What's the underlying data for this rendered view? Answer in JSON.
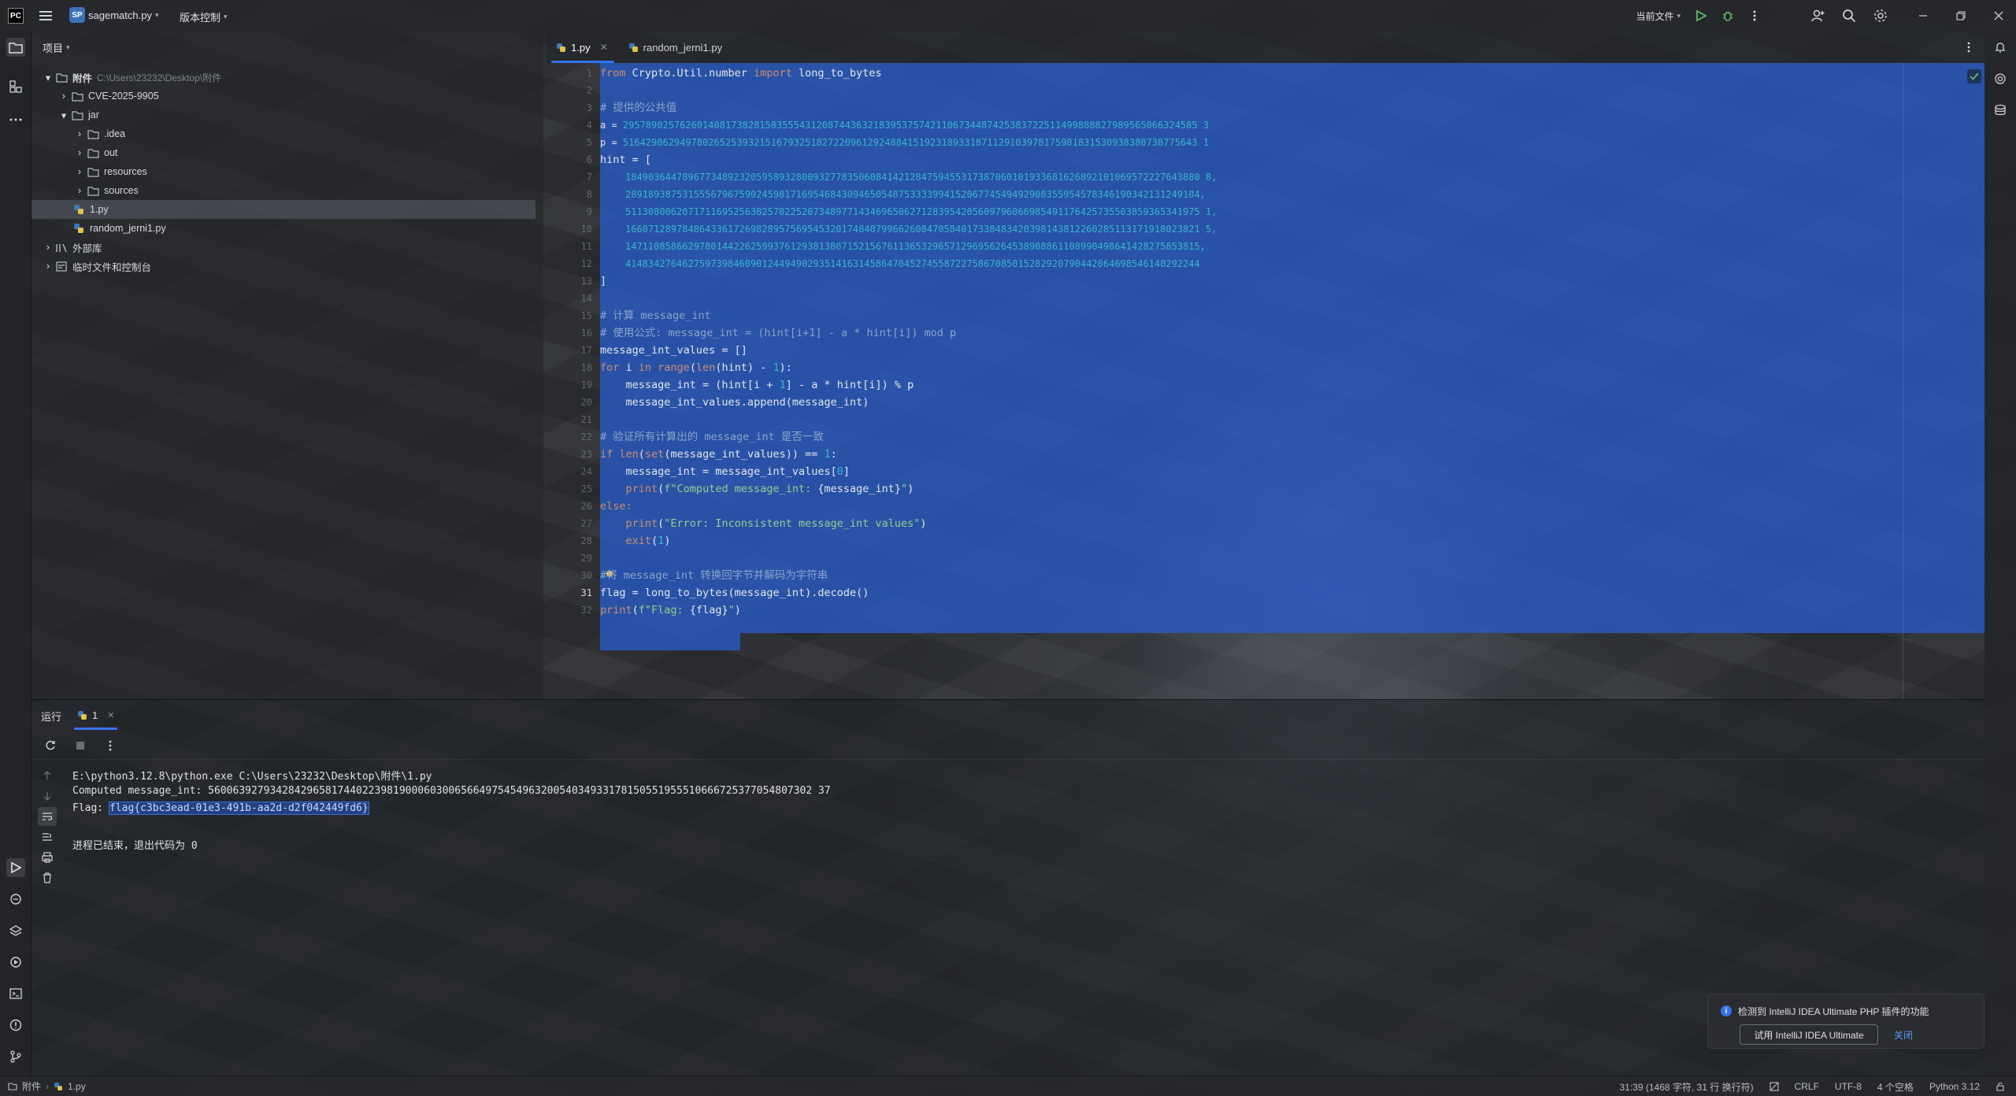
{
  "titlebar": {
    "project_badge": "SP",
    "project_name": "sagematch.py",
    "vcs_label": "版本控制",
    "run_config": "当前文件"
  },
  "project_panel": {
    "title": "项目",
    "tree": [
      {
        "label": "附件",
        "path": "C:\\Users\\23232\\Desktop\\附件"
      },
      {
        "label": "CVE-2025-9905"
      },
      {
        "label": "jar"
      },
      {
        "label": ".idea"
      },
      {
        "label": "out"
      },
      {
        "label": "resources"
      },
      {
        "label": "sources"
      },
      {
        "label": "1.py"
      },
      {
        "label": "random_jerni1.py"
      },
      {
        "label": "外部库"
      },
      {
        "label": "临时文件和控制台"
      }
    ]
  },
  "editor": {
    "tabs": [
      {
        "label": "1.py"
      },
      {
        "label": "random_jerni1.py"
      }
    ],
    "line_numbers": [
      "1",
      "2",
      "3",
      "4",
      "5",
      "6",
      "7",
      "8",
      "9",
      "10",
      "11",
      "12",
      "13",
      "14",
      "15",
      "16",
      "17",
      "18",
      "19",
      "20",
      "21",
      "22",
      "23",
      "24",
      "25",
      "26",
      "27",
      "28",
      "29",
      "30",
      "31",
      "32"
    ],
    "code": {
      "l1a": "from ",
      "l1b": "Crypto.Util.number ",
      "l1c": "import ",
      "l1d": "long_to_bytes",
      "l3": "# 提供的公共值",
      "l4a": "a = ",
      "l4b": "29578902576260140817382815835554312087443632183953757421106734487425383722511499888827989565066324585 3",
      "l5a": "p = ",
      "l5b": "51642906294978026525393215167932518272209612924884151923189331871129103978175981831530938380738775643 1",
      "l6": "hint = [",
      "l7": "18490364478967734892320595893280093277835060841421284759455317387060101933681626892101069572227643880 8,",
      "l8": "28918938753155567967590245981716954684309465054875333399415206774549492908355954578346190342131249104,",
      "l9": "51130800620717116952563825702252073489771434696506271283954205609796066985491176425735503859365341975 1,",
      "l10": "16607128978486433617269828957569545320174840799662608470584017338483420398143812260285113171918023821 5,",
      "l11": "14711085866297801442262599376129381380715215676113653296571296956264538908861108990498641428275853815,",
      "l12": "41483427646275973984609012449490293514163145864704527455872275867085015282920790442064698546140292244",
      "l13": "]",
      "l15a": "# 计算 ",
      "l15b": "message_int",
      "l16": "# 使用公式: message_int = (hint[i+1] - a * hint[i]) mod p",
      "l17": "message_int_values = []",
      "l18a": "for ",
      "l18b": "i ",
      "l18c": "in ",
      "l18d": "range",
      "l18e": "(",
      "l18f": "len",
      "l18g": "(hint) - ",
      "l18h": "1",
      "l18i": "):",
      "l19a": "    message_int = (hint[i + ",
      "l19b": "1",
      "l19c": "] - a * hint[i]) % p",
      "l20": "    message_int_values.append(message_int)",
      "l22": "# 验证所有计算出的 message_int 是否一致",
      "l23a": "if ",
      "l23b": "len",
      "l23c": "(",
      "l23d": "set",
      "l23e": "(message_int_values)) == ",
      "l23f": "1",
      "l23g": ":",
      "l24a": "    message_int = message_int_values[",
      "l24b": "0",
      "l24c": "]",
      "l25a": "    ",
      "l25b": "print",
      "l25c": "(",
      "l25d": "f\"Computed message_int: ",
      "l25e": "{message_int}",
      "l25f": "\"",
      "l25g": ")",
      "l26": "else:",
      "l27a": "    ",
      "l27b": "print",
      "l27c": "(",
      "l27d": "\"Error: Inconsistent message_int values\"",
      "l27e": ")",
      "l28a": "    ",
      "l28b": "exit",
      "l28c": "(",
      "l28d": "1",
      "l28e": ")",
      "l30": "#将 message_int 转换回字节并解码为字符串",
      "l31": "flag = long_to_bytes(message_int).decode()",
      "l32a": "print",
      "l32b": "(",
      "l32c": "f\"Flag: ",
      "l32d": "{flag}",
      "l32e": "\"",
      "l32f": ")"
    }
  },
  "run_panel": {
    "title": "运行",
    "tab_label": "1",
    "output": {
      "cmd": "E:\\python3.12.8\\python.exe C:\\Users\\23232\\Desktop\\附件\\1.py",
      "computed": "Computed message_int: 56006392793428429658174402239819000603006566497545496320054034933178150551955510666725377054807302 37",
      "flag_prefix": "Flag: ",
      "flag_value": "flag{c3bc3ead-01e3-491b-aa2d-d2f042449fd6}",
      "exit": "进程已结束，退出代码为 0"
    }
  },
  "notification": {
    "text": "检测到 IntelliJ IDEA Ultimate PHP 插件的功能",
    "action": "试用 IntelliJ IDEA Ultimate",
    "close": "关闭"
  },
  "statusbar": {
    "crumb1": "附件",
    "crumb2": "1.py",
    "position": "31:39 (1468 字符, 31 行 换行符)",
    "line_sep": "CRLF",
    "encoding": "UTF-8",
    "indent": "4 个空格",
    "interpreter": "Python 3.12"
  },
  "colors": {
    "accent": "#3574f0",
    "selection": "#285cc8",
    "keyword": "#cf8e6d",
    "comment": "#8aa4c8",
    "number": "#39b5c9",
    "string": "#8fd18a"
  }
}
